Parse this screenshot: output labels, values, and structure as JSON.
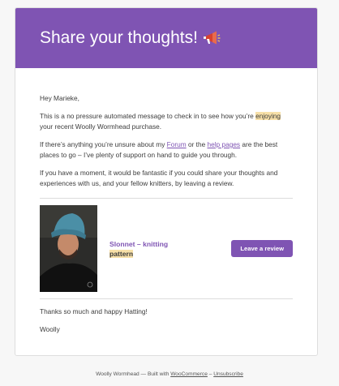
{
  "header": {
    "title": "Share your thoughts!",
    "icon": "megaphone-icon",
    "bg_color": "#7f54b3"
  },
  "body": {
    "greeting": "Hey Marieke,",
    "p1_a": "This is a no pressure automated message to check in to see how you’re ",
    "p1_hl": "enjoying",
    "p1_b": " your recent Woolly Wormhead purchase.",
    "p2_a": "If there’s anything you’re unsure about my ",
    "p2_link1": "Forum",
    "p2_b": " or the ",
    "p2_link2": "help pages",
    "p2_c": " are the best places to go – I’ve plenty of support on hand to guide you through.",
    "p3": "If you have a moment, it would be fantastic if you could share your thoughts and experiences with us, and your fellow knitters, by leaving a review.",
    "closing": "Thanks so much and happy Hatting!",
    "signature": "Woolly"
  },
  "product": {
    "name_line1": "Slonnet – knitting",
    "name_line2": "pattern",
    "review_button": "Leave a review",
    "image_icon": "knitted-hat-model-photo"
  },
  "footer": {
    "prefix": "Woolly Wormhead — Built with ",
    "woocommerce": "WooCommerce",
    "separator": " – ",
    "unsubscribe": "Unsubscribe"
  }
}
